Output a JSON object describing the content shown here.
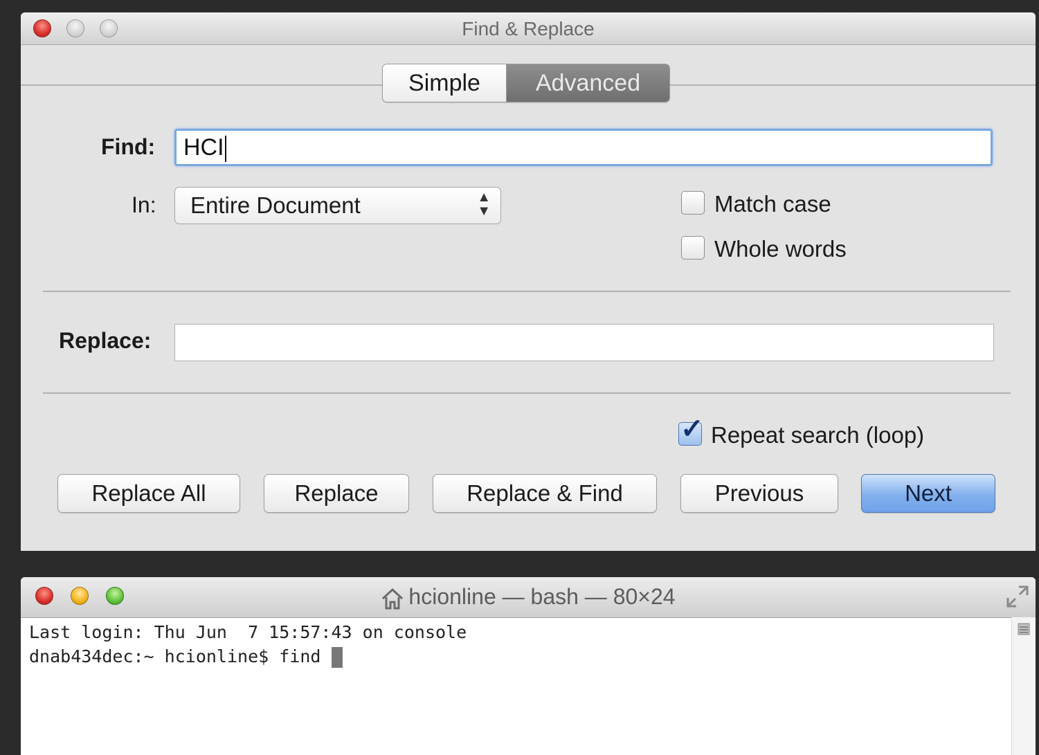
{
  "find_replace_window": {
    "title": "Find & Replace",
    "tabs": [
      {
        "label": "Simple",
        "selected": false
      },
      {
        "label": "Advanced",
        "selected": true
      }
    ],
    "find_label": "Find:",
    "find_value": "HCI",
    "in_label": "In:",
    "in_value": "Entire Document",
    "match_case_label": "Match case",
    "match_case_checked": false,
    "whole_words_label": "Whole words",
    "whole_words_checked": false,
    "replace_label": "Replace:",
    "replace_value": "",
    "repeat_label": "Repeat search (loop)",
    "repeat_checked": true,
    "buttons": {
      "replace_all": "Replace All",
      "replace": "Replace",
      "replace_find": "Replace & Find",
      "previous": "Previous",
      "next": "Next"
    }
  },
  "terminal_window": {
    "title": "hcionline — bash — 80×24",
    "lines": [
      "Last login: Thu Jun  7 15:57:43 on console",
      "dnab434dec:~ hcionline$ find "
    ]
  },
  "colors": {
    "accent_blue": "#7ba7e0",
    "default_button": "#82b0ec",
    "close_red": "#d8302a",
    "minimize_yellow": "#f3b21f",
    "maximize_green": "#5fc23a"
  },
  "icons": [
    "close-button",
    "minimize-button",
    "zoom-button",
    "home-icon",
    "resize-icon",
    "up-down-arrows-icon",
    "checkmark-icon",
    "scroll-icon"
  ]
}
